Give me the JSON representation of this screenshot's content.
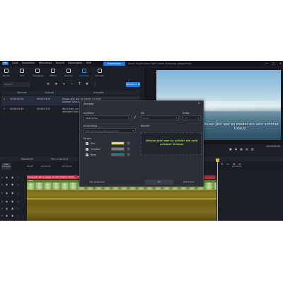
{
  "titlebar": {
    "logo_text": "PV",
    "menu": [
      "Datei",
      "Bearbeiten",
      "Werkzeuge",
      "Ansicht",
      "Wiedergabe",
      "Hilfe"
    ],
    "export_label": "Exportieren",
    "project_title": "Neues Projekt ohne Titel*   Letzte Sicherung: gespeichert",
    "controls": [
      "—",
      "□",
      "✕"
    ]
  },
  "toolbar": {
    "tools": [
      {
        "label": "Medien",
        "icon": "media-icon"
      },
      {
        "label": "Text",
        "icon": "text-icon"
      },
      {
        "label": "Übergänge",
        "icon": "transition-icon"
      },
      {
        "label": "Effekte",
        "icon": "effects-icon"
      },
      {
        "label": "Overlays",
        "icon": "overlays-icon"
      },
      {
        "label": "Untertitel",
        "icon": "subtitles-icon",
        "active": true
      },
      {
        "label": "Vorlagen",
        "icon": "templates-icon"
      }
    ]
  },
  "subtitles": {
    "search_placeholder": "Suchen",
    "speech_button": "Sprache in Text",
    "columns": [
      "Startzeit",
      "Endzeit",
      "Untertitel"
    ],
    "rows": [
      {
        "index": "1",
        "start": "00:00:00:00",
        "end": "00:00:03:19",
        "text": "Dieses Jahr war es wieder ein sehr schöner Urlaub."
      },
      {
        "index": "2",
        "start": "00:00:03:20",
        "end": "00:00:07:17",
        "text": "Wir freuen uns schon auf den nächsten Urlaub."
      }
    ]
  },
  "preview": {
    "subtitle": "Dieses Jahr war es wieder ein sehr schöner Urlaub.",
    "timecode": "00:00:00:00"
  },
  "timeline": {
    "tabs": [
      "Bearbeiten",
      "Text in Sprache"
    ],
    "left_button": "Alles anzeigen",
    "ruler": [
      "00:00",
      "00:00:05",
      "00:00:10",
      "00:00:15",
      "00:00:20",
      "00:00:25",
      "00:00:30",
      "00:00:35",
      "00:00:40",
      "00:00:45"
    ],
    "tracks": [
      "1",
      "2",
      "3",
      "4",
      "5",
      "6"
    ],
    "subtitle_clip_1": "Dieses Jahr war es wieder ein sehr schöner Urlaub.",
    "subtitle_clip_2": "Wir freuen uns schon auf den nächsten Urlaub.",
    "video_clip": "Video"
  },
  "dialog": {
    "title": "Zeichen",
    "font_label": "Schriftart",
    "font_value": "Fatima One",
    "style_label": "Stil",
    "style_value": "Kursiv",
    "size_label": "Größe",
    "size_value": "18",
    "align_label": "Ausrichtung",
    "align_value": "Mehrfachtext richtig ausrichten",
    "sample_label": "Beispiel",
    "sample_text": "Dieses Jahr war es wieder ein sehr schöner Urlaub.",
    "colors_label": "Farben",
    "colors": [
      {
        "label": "Text",
        "hex": "#f5ef1a"
      },
      {
        "label": "Schatten",
        "hex": "#7a7e86"
      },
      {
        "label": "Rand",
        "hex": "#11807a"
      }
    ],
    "apply_all": "Alle anwenden",
    "ok": "OK",
    "cancel": "Abbrechen"
  }
}
